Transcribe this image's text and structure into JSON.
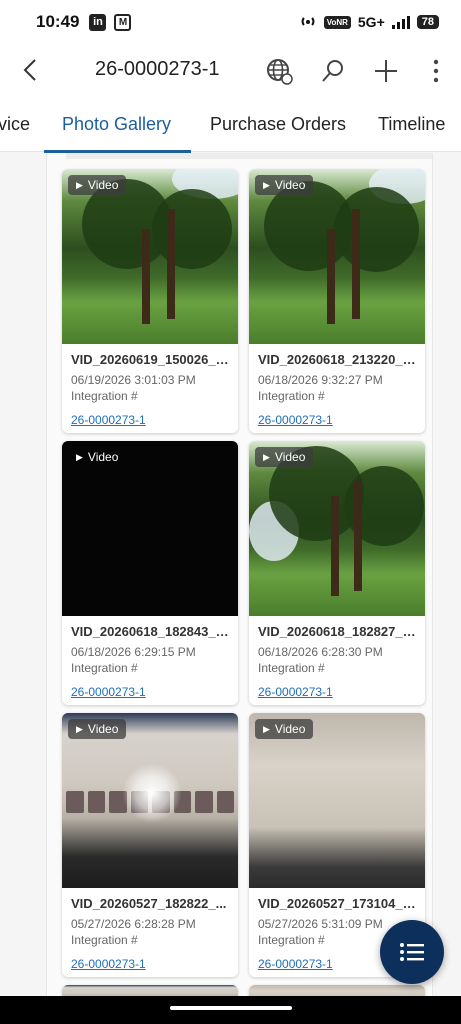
{
  "status": {
    "time": "10:49",
    "network": "5G+",
    "battery": "78",
    "volte": "VoNR"
  },
  "header": {
    "title": "26-0000273-1"
  },
  "tabs": [
    {
      "label": "vice"
    },
    {
      "label": "Photo Gallery"
    },
    {
      "label": "Purchase Orders"
    },
    {
      "label": "Timeline"
    }
  ],
  "gallery": {
    "badge_label": "Video",
    "items": [
      {
        "name": "VID_20260619_150026_0...",
        "date": "06/19/2026 3:01:03 PM",
        "integration": "Integration #",
        "link": "26-0000273-1"
      },
      {
        "name": "VID_20260618_213220_0...",
        "date": "06/18/2026 9:32:27 PM",
        "integration": "Integration #",
        "link": "26-0000273-1"
      },
      {
        "name": "VID_20260618_182843_1...",
        "date": "06/18/2026 6:29:15 PM",
        "integration": "Integration #",
        "link": "26-0000273-1"
      },
      {
        "name": "VID_20260618_182827_0...",
        "date": "06/18/2026 6:28:30 PM",
        "integration": "Integration #",
        "link": "26-0000273-1"
      },
      {
        "name": "VID_20260527_182822_...",
        "date": "05/27/2026 6:28:28 PM",
        "integration": "Integration #",
        "link": "26-0000273-1"
      },
      {
        "name": "VID_20260527_173104_0...",
        "date": "05/27/2026 5:31:09 PM",
        "integration": "Integration #",
        "link": "26-0000273-1"
      }
    ]
  },
  "colors": {
    "accent": "#1b5f9e",
    "link": "#1e6fb8",
    "fab": "#0d2f5c"
  }
}
